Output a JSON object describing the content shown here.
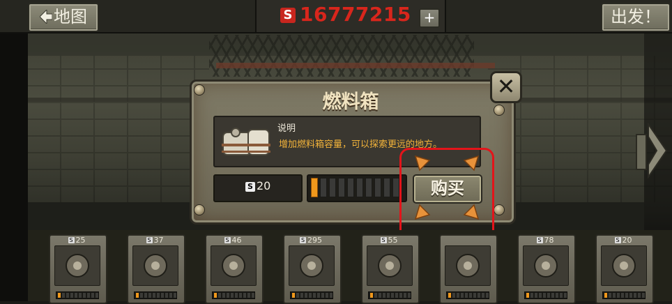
{
  "top_bar": {
    "map_button": {
      "icon": "left-arrow-icon",
      "label": "地图"
    },
    "money": {
      "currency_icon": "S",
      "value": "16777215",
      "color": "#d8261c"
    },
    "add_money_button": "+",
    "depart_button": "出发！"
  },
  "modal": {
    "title": "燃料箱",
    "close_icon": "close-x-icon",
    "item_icon": "fuel-tank-icon",
    "description_title": "说明",
    "description_text": "增加燃料箱容量，可以探索更远的地方。",
    "price_currency": "S",
    "price": "20",
    "level": {
      "current": 1,
      "max": 10,
      "fill_color": "#f0981c"
    },
    "buy_button": "购买",
    "highlight_color": "#e3141a"
  },
  "shop": {
    "items": [
      {
        "price": "25",
        "icon": "engine-icon",
        "level": 1
      },
      {
        "price": "37",
        "icon": "gearbox-icon",
        "level": 1
      },
      {
        "price": "46",
        "icon": "wheel-icon",
        "level": 1
      },
      {
        "price": "295",
        "icon": "rifle-icon",
        "level": 1
      },
      {
        "price": "55",
        "icon": "drill-icon",
        "level": 1
      },
      {
        "price": "",
        "icon": "speaker-icon",
        "level": 1
      },
      {
        "price": "78",
        "icon": "frame-icon",
        "level": 1
      },
      {
        "price": "20",
        "icon": "fuel-tank-icon",
        "level": 1
      }
    ],
    "max_level": 10
  },
  "navigation": {
    "next_icon": "right-arrow-icon"
  }
}
